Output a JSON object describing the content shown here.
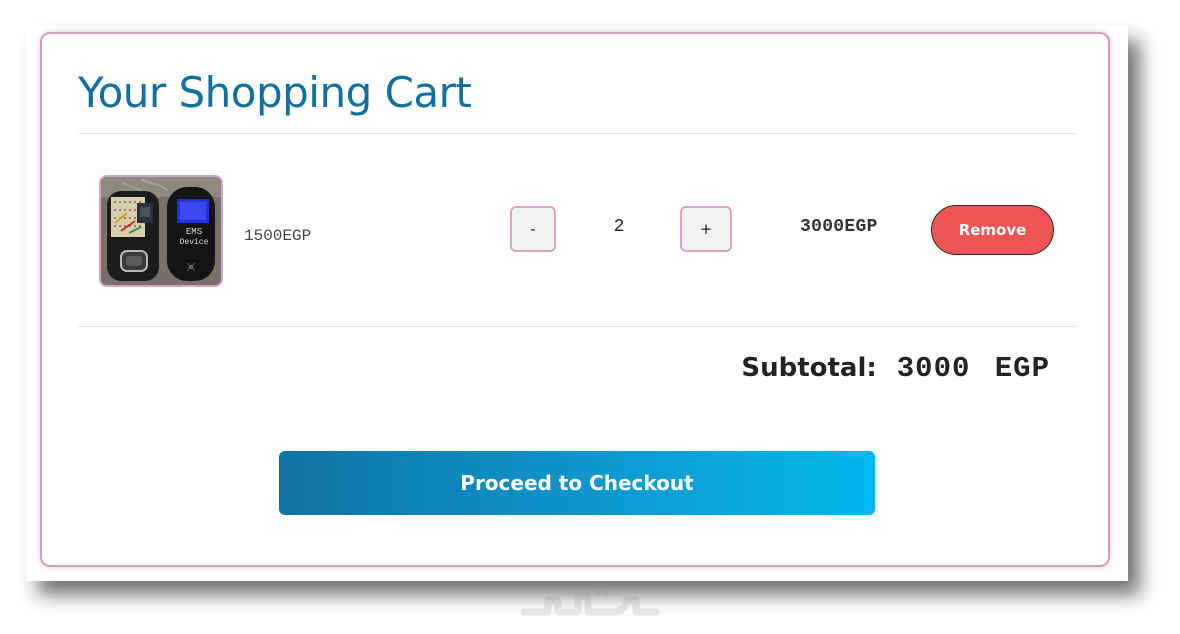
{
  "cart": {
    "title": "Your Shopping Cart",
    "items": [
      {
        "image_label_line1": "EMS",
        "image_label_line2": "Device",
        "unit_price": "1500EGP",
        "quantity": "2",
        "decrement_label": "-",
        "increment_label": "+",
        "line_total": "3000EGP",
        "remove_label": "Remove"
      }
    ],
    "subtotal_label": "Subtotal:",
    "subtotal_value": "3000 EGP",
    "checkout_label": "Proceed to Checkout"
  },
  "colors": {
    "title": "#12709c",
    "remove_button": "#ef5454",
    "checkout_start": "#0f71a3",
    "checkout_end": "#00b8ec",
    "card_border": "#cf9fc0"
  },
  "icons": {
    "watermark": "watermark-logo"
  }
}
